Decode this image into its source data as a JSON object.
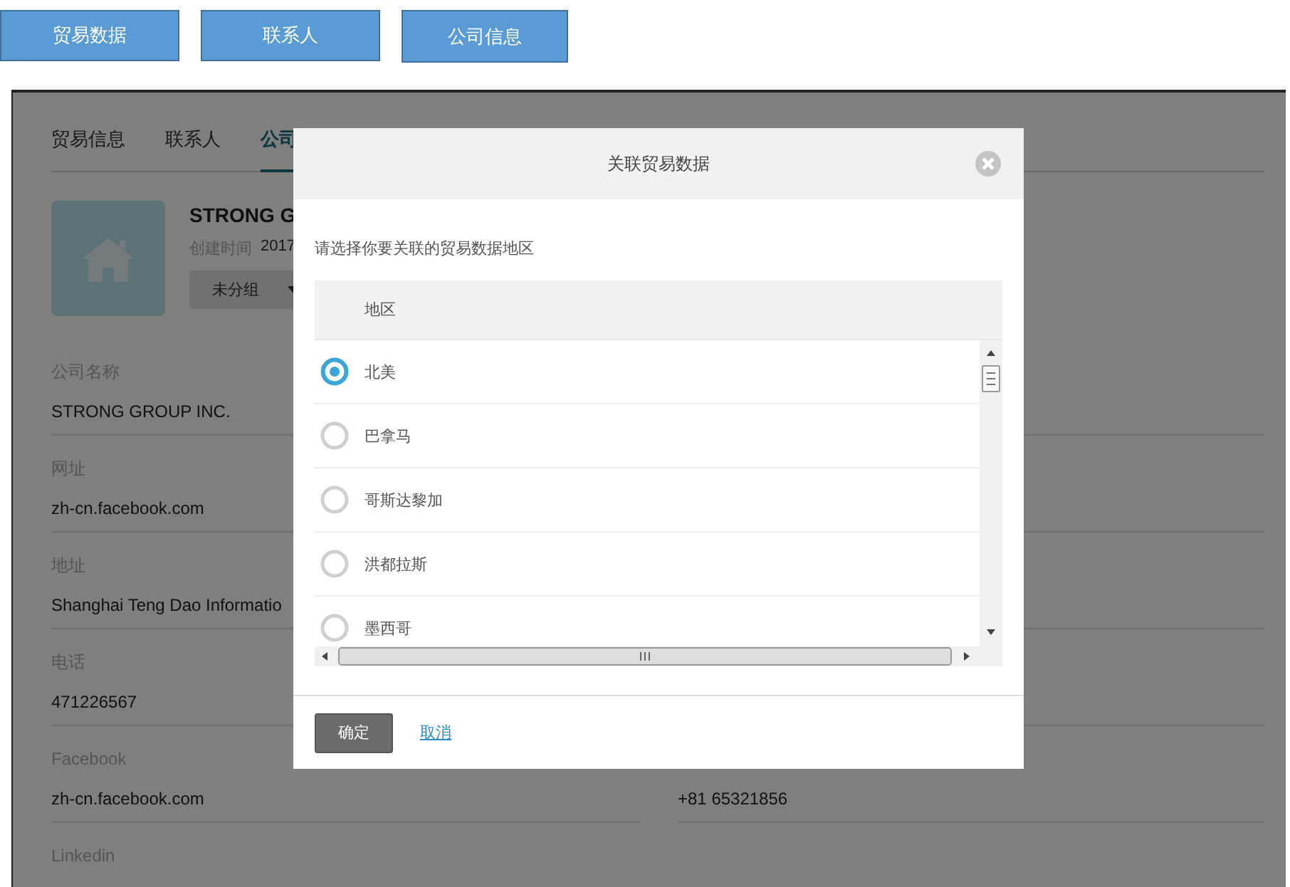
{
  "top_buttons": [
    "贸易数据",
    "联系人",
    "公司信息"
  ],
  "page": {
    "tabs": [
      {
        "label": "贸易信息",
        "selected": false
      },
      {
        "label": "联系人",
        "selected": false
      },
      {
        "label": "公司",
        "selected": true
      }
    ],
    "company": {
      "name": "STRONG G",
      "created_label": "创建时间",
      "created_value": "2017",
      "group": "未分组"
    },
    "fields_left": [
      {
        "label": "公司名称",
        "value": "STRONG GROUP INC."
      },
      {
        "label": "网址",
        "value": "zh-cn.facebook.com"
      },
      {
        "label": "地址",
        "value": "Shanghai Teng Dao Informatio"
      },
      {
        "label": "电话",
        "value": "471226567"
      },
      {
        "label": "Facebook",
        "value": "zh-cn.facebook.com"
      },
      {
        "label": "Linkedin"
      }
    ],
    "right_column": {
      "value": "+81 65321856"
    }
  },
  "dialog": {
    "title": "关联贸易数据",
    "prompt": "请选择你要关联的贸易数据地区",
    "column": "地区",
    "regions": [
      {
        "name": "北美",
        "selected": true
      },
      {
        "name": "巴拿马",
        "selected": false
      },
      {
        "name": "哥斯达黎加",
        "selected": false
      },
      {
        "name": "洪都拉斯",
        "selected": false
      },
      {
        "name": "墨西哥",
        "selected": false
      }
    ],
    "confirm": "确定",
    "cancel": "取消"
  }
}
